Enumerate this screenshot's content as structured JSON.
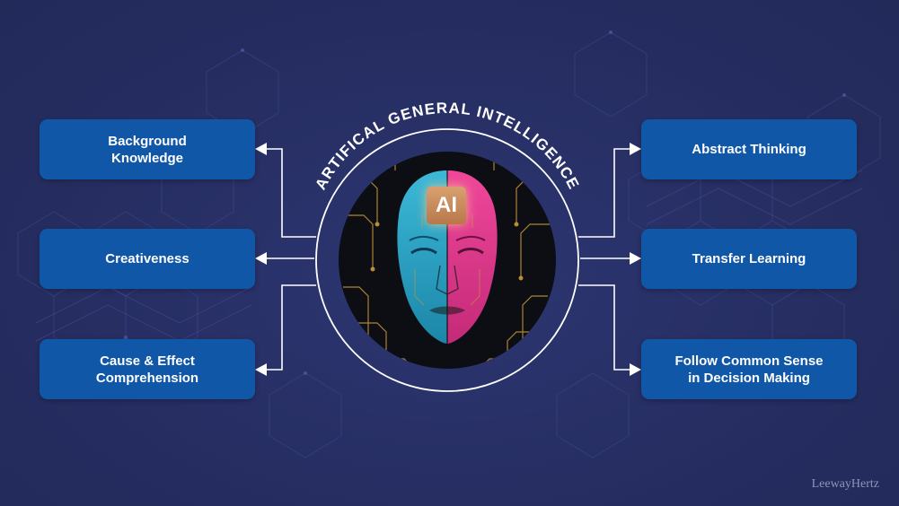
{
  "title": "ARTIFICAL GENERAL INTELLIGENCE",
  "badge": "AI",
  "left_items": [
    {
      "label": "Background Knowledge",
      "lines": [
        "Background",
        "Knowledge"
      ]
    },
    {
      "label": "Creativeness",
      "lines": [
        "Creativeness"
      ]
    },
    {
      "label": "Cause & Effect Comprehension",
      "lines": [
        "Cause & Effect",
        "Comprehension"
      ]
    }
  ],
  "right_items": [
    {
      "label": "Abstract Thinking",
      "lines": [
        "Abstract Thinking"
      ]
    },
    {
      "label": "Transfer Learning",
      "lines": [
        "Transfer Learning"
      ]
    },
    {
      "label": "Follow Common Sense in Decision Making",
      "lines": [
        "Follow Common Sense",
        "in Decision Making"
      ]
    }
  ],
  "watermark": "LeewayHertz",
  "colors": {
    "background": "#262e62",
    "box": "#1157a8",
    "face_left": "#2aa6c8",
    "face_right": "#e23a8c",
    "circuit": "#c89a3a"
  },
  "icons": [
    "arrow-left-icon",
    "arrow-right-icon",
    "face-icon"
  ]
}
